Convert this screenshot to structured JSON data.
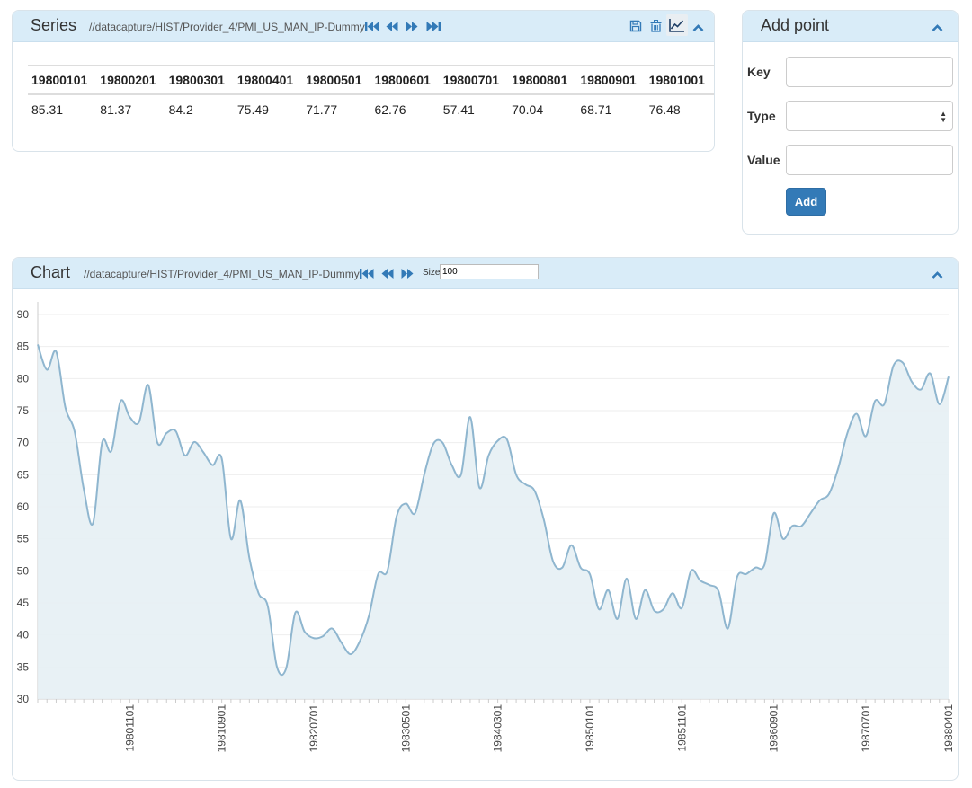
{
  "series_panel": {
    "title": "Series",
    "path": "//datacapture/HIST/Provider_4/PMI_US_MAN_IP-Dummy",
    "nav_icons": [
      "first-page-icon",
      "previous-icon",
      "next-icon",
      "last-page-icon"
    ],
    "action_icons": [
      "save-icon",
      "trash-icon",
      "line-chart-icon"
    ],
    "collapse_icon": "chevron-up-icon",
    "table": {
      "headers": [
        "19800101",
        "19800201",
        "19800301",
        "19800401",
        "19800501",
        "19800601",
        "19800701",
        "19800801",
        "19800901",
        "19801001"
      ],
      "values": [
        "85.31",
        "81.37",
        "84.2",
        "75.49",
        "71.77",
        "62.76",
        "57.41",
        "70.04",
        "68.71",
        "76.48"
      ]
    }
  },
  "add_point_panel": {
    "title": "Add point",
    "collapse_icon": "chevron-up-icon",
    "key_label": "Key",
    "key_value": "",
    "type_label": "Type",
    "type_selected": "",
    "value_label": "Value",
    "value_value": "",
    "add_button": "Add"
  },
  "chart_panel": {
    "title": "Chart",
    "path": "//datacapture/HIST/Provider_4/PMI_US_MAN_IP-Dummy",
    "nav_icons": [
      "first-page-icon",
      "previous-icon",
      "next-icon"
    ],
    "size_label": "Size",
    "size_value": "100",
    "collapse_icon": "chevron-up-icon"
  },
  "colors": {
    "accent": "#337ab7",
    "header_bg": "#d9ecf8",
    "line": "#8fb6cf",
    "area": "#e6eff4"
  },
  "chart_data": {
    "type": "area",
    "title": "",
    "xlabel": "",
    "ylabel": "",
    "ylim": [
      30,
      90
    ],
    "yticks": [
      30,
      35,
      40,
      45,
      50,
      55,
      60,
      65,
      70,
      75,
      80,
      85,
      90
    ],
    "xtick_labels": [
      "19801101",
      "19810901",
      "19820701",
      "19830501",
      "19840301",
      "19850101",
      "19851101",
      "19860901",
      "19870701",
      "19880401"
    ],
    "grid": true,
    "x": [
      "19800101",
      "19800201",
      "19800301",
      "19800401",
      "19800501",
      "19800601",
      "19800701",
      "19800801",
      "19800901",
      "19801001",
      "19801101",
      "19801201",
      "19810101",
      "19810201",
      "19810301",
      "19810401",
      "19810501",
      "19810601",
      "19810701",
      "19810801",
      "19810901",
      "19811001",
      "19811101",
      "19811201",
      "19820101",
      "19820201",
      "19820301",
      "19820401",
      "19820501",
      "19820601",
      "19820701",
      "19820801",
      "19820901",
      "19821001",
      "19821101",
      "19821201",
      "19830101",
      "19830201",
      "19830301",
      "19830401",
      "19830501",
      "19830601",
      "19830701",
      "19830801",
      "19830901",
      "19831001",
      "19831101",
      "19831201",
      "19840101",
      "19840201",
      "19840301",
      "19840401",
      "19840501",
      "19840601",
      "19840701",
      "19840801",
      "19840901",
      "19841001",
      "19841101",
      "19841201",
      "19850101",
      "19850201",
      "19850301",
      "19850401",
      "19850501",
      "19850601",
      "19850701",
      "19850801",
      "19850901",
      "19851001",
      "19851101",
      "19851201",
      "19860101",
      "19860201",
      "19860301",
      "19860401",
      "19860501",
      "19860601",
      "19860701",
      "19860801",
      "19860901",
      "19861001",
      "19861101",
      "19861201",
      "19870101",
      "19870201",
      "19870301",
      "19870401",
      "19870501",
      "19870601",
      "19870701",
      "19870801",
      "19870901",
      "19871001",
      "19871101",
      "19871201",
      "19880101",
      "19880201",
      "19880301",
      "19880401"
    ],
    "values": [
      85.31,
      81.37,
      84.2,
      75.49,
      71.77,
      62.76,
      57.41,
      70.04,
      68.71,
      76.48,
      74.0,
      73.2,
      79.0,
      70.0,
      71.5,
      71.8,
      68.0,
      70.1,
      68.5,
      66.5,
      67.5,
      55.0,
      61.0,
      52.0,
      46.5,
      44.5,
      35.0,
      34.8,
      43.5,
      40.5,
      39.5,
      39.8,
      41.0,
      38.8,
      37.0,
      39.0,
      43.0,
      49.5,
      50.0,
      58.5,
      60.5,
      59.0,
      65.0,
      69.8,
      70.0,
      66.5,
      65.0,
      74.0,
      63.0,
      68.0,
      70.3,
      70.5,
      65.0,
      63.5,
      62.5,
      58.0,
      51.5,
      50.5,
      54.0,
      50.5,
      49.5,
      44.0,
      47.0,
      42.5,
      48.8,
      42.5,
      47.0,
      43.8,
      44.0,
      46.5,
      44.2,
      50.0,
      48.5,
      47.8,
      46.8,
      41.0,
      49.0,
      49.5,
      50.5,
      51.0,
      59.0,
      55.0,
      57.0,
      57.0,
      59.0,
      61.0,
      62.0,
      66.0,
      71.5,
      74.5,
      71.0,
      76.5,
      76.0,
      82.0,
      82.5,
      79.5,
      78.3,
      80.8,
      76.0,
      80.3
    ]
  }
}
